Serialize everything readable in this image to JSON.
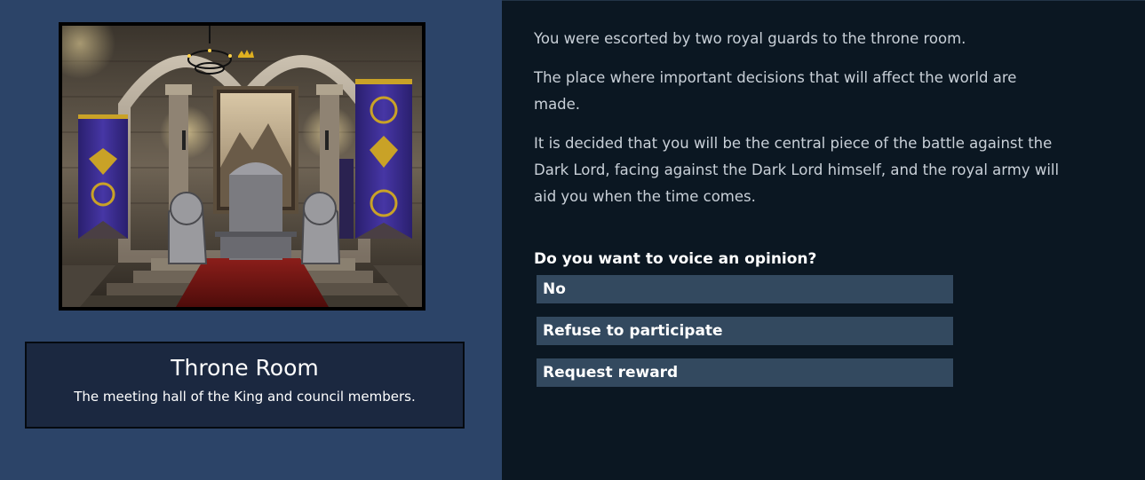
{
  "location": {
    "title": "Throne Room",
    "description": "The meeting hall of the King and council members."
  },
  "story": {
    "paragraphs": [
      "You were escorted by two royal guards to the throne room.",
      "The place where important decisions that will affect the world are made.",
      "It is decided that you will be the central piece of the battle against the Dark Lord, facing against the Dark Lord himself, and the royal army will aid you when the time comes."
    ]
  },
  "prompt": {
    "question": "Do you want to voice an opinion?",
    "choices": [
      "No",
      "Refuse to participate",
      "Request reward"
    ]
  },
  "colors": {
    "left_panel_bg": "#2c4468",
    "right_panel_bg": "#0b1722",
    "choice_bg": "#33495f",
    "banner_purple": "#3a2f8e",
    "banner_gold": "#c9a227"
  }
}
